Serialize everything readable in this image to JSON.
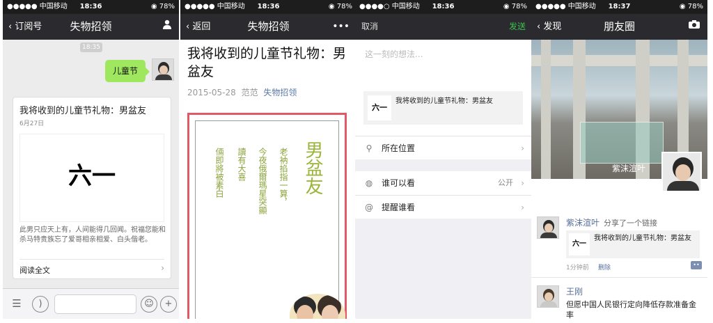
{
  "status_bars": [
    {
      "carrier": "●●●●● 中国移动 ",
      "time": "18:36",
      "battery": "◉ 78%"
    },
    {
      "carrier": "●●●●● 中国移动 ",
      "time": "18:36",
      "battery": "◉ 78%"
    },
    {
      "carrier": "●●●●○ 中国移动 ",
      "time": "18:36",
      "battery": "◉ 78%"
    },
    {
      "carrier": "●●●●● 中国移动 ",
      "time": "18:37",
      "battery": "◉ 78%"
    }
  ],
  "chat": {
    "back_label": "订阅号",
    "title": "失物招领",
    "time_chip": "18:35",
    "message": "儿童节",
    "card": {
      "title": "我将收到的儿童节礼物：男盆友",
      "date": "6月27日",
      "cover_text": "六一",
      "desc": "此男只应天上有，人间能得几回闻。祝福您能和杀马特贵族忘了爱哥相亲相爱、白头偕老。",
      "read_all": "阅读全文"
    }
  },
  "article": {
    "back_label": "返回",
    "title": "失物招领",
    "more": "•••",
    "headline": "我将收到的儿童节礼物：男盆友",
    "date": "2015-05-28",
    "author": "范范",
    "account": "失物招领",
    "poster": {
      "big": "男盆友",
      "col1": "老衲掐指一算，",
      "col2": "今夜俄爾瑪星突顯",
      "col3": "讀有大喜",
      "col4": "倆即將被素白"
    }
  },
  "compose": {
    "cancel": "取消",
    "send": "发送",
    "placeholder": "这一刻的想法...",
    "link_thumb": "六一",
    "link_title": "我将收到的儿童节礼物：男盆友",
    "location": "所在位置",
    "who_can_see": "谁可以看",
    "who_can_see_value": "公开",
    "remind": "提醒谁看"
  },
  "moments": {
    "back_label": "发现",
    "title": "朋友圈",
    "cover_name": "紫沫渲叶",
    "post1": {
      "name": "紫沫渲叶",
      "action": "分享了一个链接",
      "link_thumb": "六一",
      "link_title": "我将收到的儿童节礼物：男盆友",
      "time": "1分钟前",
      "delete": "删除"
    },
    "post2": {
      "name": "王刚",
      "text": "但愿中国人民银行定向降低存款准备金率"
    }
  }
}
